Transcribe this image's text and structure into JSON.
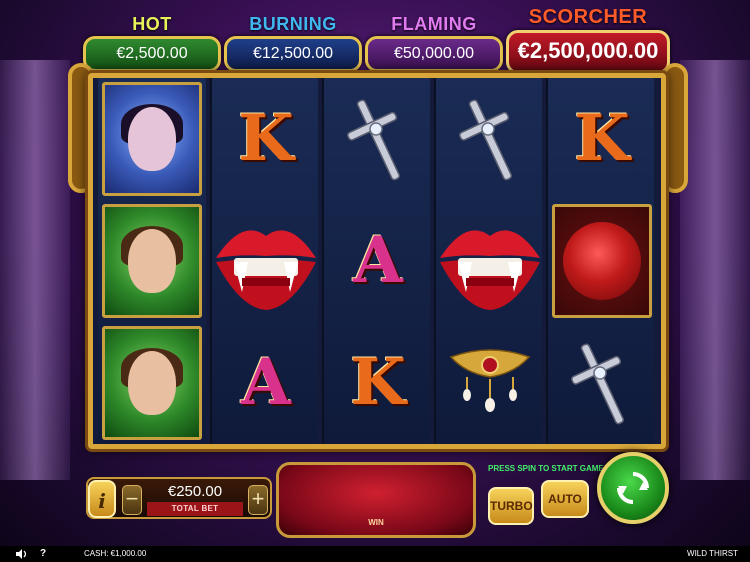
{
  "jackpots": {
    "hot": {
      "title": "HOT",
      "value": "€2,500.00"
    },
    "burning": {
      "title": "BURNING",
      "value": "€12,500.00"
    },
    "flaming": {
      "title": "FLAMING",
      "value": "€50,000.00"
    },
    "scorcher": {
      "title": "SCORCHER",
      "value": "€2,500,000.00"
    }
  },
  "reels": [
    [
      "vampire-woman",
      "man-portrait",
      "man-portrait"
    ],
    [
      "K",
      "lips",
      "A"
    ],
    [
      "cross",
      "A",
      "K"
    ],
    [
      "cross",
      "lips",
      "pendant"
    ],
    [
      "K",
      "rose",
      "cross"
    ]
  ],
  "symbols": {
    "K": "K",
    "A": "A"
  },
  "controls": {
    "info_label": "i",
    "minus_label": "−",
    "plus_label": "+",
    "bet_value": "€250.00",
    "bet_label": "TOTAL BET",
    "win_label": "WIN",
    "prompt": "PRESS SPIN TO START GAME",
    "turbo_label": "TURBO",
    "auto_label": "AUTO"
  },
  "status": {
    "help": "?",
    "cash": "CASH: €1,000.00",
    "game_name": "WILD THIRST"
  },
  "colors": {
    "accent_gold": "#d9a63a",
    "spin_green": "#1a8a1a"
  }
}
